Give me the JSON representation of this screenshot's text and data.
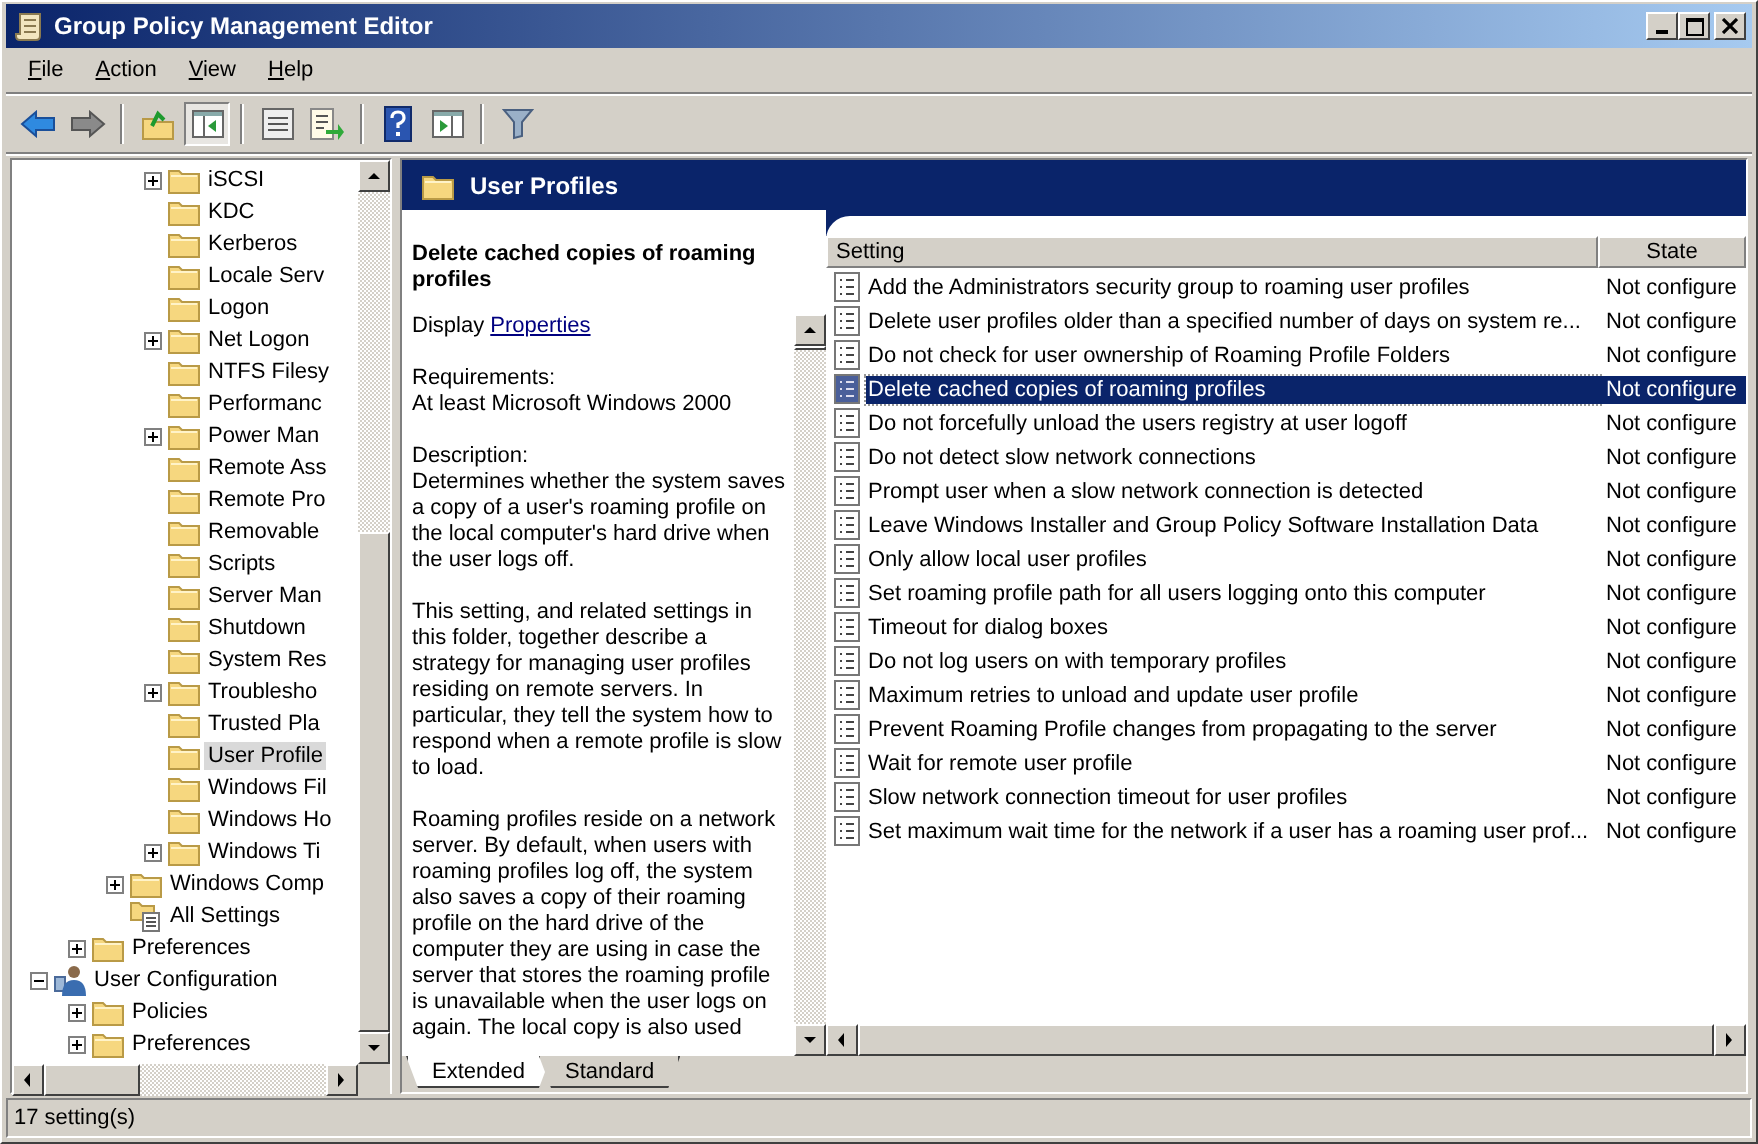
{
  "window": {
    "title": "Group Policy Management Editor"
  },
  "menu": [
    "File",
    "Action",
    "View",
    "Help"
  ],
  "toolbar": [
    [
      {
        "kind": "back",
        "pressed": false
      },
      {
        "kind": "forward",
        "pressed": false
      }
    ],
    [
      {
        "kind": "up",
        "pressed": false
      },
      {
        "kind": "tree",
        "pressed": true
      }
    ],
    [
      {
        "kind": "properties",
        "pressed": false
      },
      {
        "kind": "export",
        "pressed": false
      }
    ],
    [
      {
        "kind": "help",
        "pressed": false
      },
      {
        "kind": "action-pane",
        "pressed": false
      }
    ],
    [
      {
        "kind": "filter",
        "pressed": false
      }
    ]
  ],
  "tree": [
    {
      "children": [
        {
          "children": [
            {
              "children": [
                {
                  "label": "iSCSI",
                  "kind": "folder",
                  "expanded": false,
                  "selected": false
                },
                {
                  "label": "KDC",
                  "kind": "folder",
                  "selected": false
                },
                {
                  "label": "Kerberos",
                  "kind": "folder",
                  "selected": false
                },
                {
                  "label": "Locale Serv",
                  "kind": "folder",
                  "selected": false
                },
                {
                  "label": "Logon",
                  "kind": "folder",
                  "selected": false
                },
                {
                  "label": "Net Logon",
                  "kind": "folder",
                  "expanded": false,
                  "selected": false
                },
                {
                  "label": "NTFS Filesy",
                  "kind": "folder",
                  "selected": false
                },
                {
                  "label": "Performanc",
                  "kind": "folder",
                  "selected": false
                },
                {
                  "label": "Power Man",
                  "kind": "folder",
                  "expanded": false,
                  "selected": false
                },
                {
                  "label": "Remote Ass",
                  "kind": "folder",
                  "selected": false
                },
                {
                  "label": "Remote Pro",
                  "kind": "folder",
                  "selected": false
                },
                {
                  "label": "Removable",
                  "kind": "folder",
                  "selected": false
                },
                {
                  "label": "Scripts",
                  "kind": "folder",
                  "selected": false
                },
                {
                  "label": "Server Man",
                  "kind": "folder",
                  "selected": false
                },
                {
                  "label": "Shutdown",
                  "kind": "folder",
                  "selected": false
                },
                {
                  "label": "System Res",
                  "kind": "folder",
                  "selected": false
                },
                {
                  "label": "Troublesho",
                  "kind": "folder",
                  "expanded": false,
                  "selected": false
                },
                {
                  "label": "Trusted Pla",
                  "kind": "folder",
                  "selected": false
                },
                {
                  "label": "User Profile",
                  "kind": "folder",
                  "selected": true
                },
                {
                  "label": "Windows Fil",
                  "kind": "folder",
                  "selected": false
                },
                {
                  "label": "Windows Ho",
                  "kind": "folder",
                  "selected": false
                },
                {
                  "label": "Windows Ti",
                  "kind": "folder",
                  "expanded": false,
                  "selected": false
                }
              ]
            },
            {
              "label": "Windows Comp",
              "kind": "folder",
              "expanded": false,
              "selected": false
            },
            {
              "label": "All Settings",
              "kind": "settings",
              "selected": false
            }
          ]
        },
        {
          "label": "Preferences",
          "kind": "folder",
          "expanded": false,
          "selected": false
        }
      ]
    },
    {
      "label": "User Configuration",
      "kind": "user",
      "expanded": true,
      "selected": false,
      "children": [
        {
          "label": "Policies",
          "kind": "folder",
          "expanded": false,
          "selected": false
        },
        {
          "label": "Preferences",
          "kind": "folder",
          "expanded": false,
          "selected": false
        }
      ]
    }
  ],
  "details": {
    "header": "User Profiles",
    "title": "Delete cached copies of roaming profiles",
    "display_label": "Display",
    "display_link": "Properties",
    "requirements_label": "Requirements:",
    "requirements": "At least Microsoft Windows 2000",
    "description_label": "Description:",
    "paragraphs": [
      "Determines whether the system saves a copy of a user's roaming profile on the local computer's hard drive when the user logs off.",
      "This setting, and related settings in this folder, together describe a strategy for managing user profiles residing on remote servers. In particular, they tell the system how to respond when a remote profile is slow to load.",
      "Roaming profiles reside on a network server. By default, when users with roaming profiles log off, the system also saves a copy of their roaming profile on the hard drive of the computer they are using in case the server that stores the roaming profile is unavailable when the user logs on again. The local copy is also used"
    ]
  },
  "tabs": [
    {
      "label": "Extended",
      "selected": true
    },
    {
      "label": "Standard",
      "selected": false
    }
  ],
  "settings": {
    "columns": [
      "Setting",
      "State"
    ],
    "rows": [
      {
        "setting": "Add the Administrators security group to roaming user profiles",
        "state": "Not configure",
        "selected": false
      },
      {
        "setting": "Delete user profiles older than a specified number of days on system re...",
        "state": "Not configure",
        "selected": false
      },
      {
        "setting": "Do not check for user ownership of Roaming Profile Folders",
        "state": "Not configure",
        "selected": false
      },
      {
        "setting": "Delete cached copies of roaming profiles",
        "state": "Not configure",
        "selected": true
      },
      {
        "setting": "Do not forcefully unload the users registry at user logoff",
        "state": "Not configure",
        "selected": false
      },
      {
        "setting": "Do not detect slow network connections",
        "state": "Not configure",
        "selected": false
      },
      {
        "setting": "Prompt user when a slow network connection is detected",
        "state": "Not configure",
        "selected": false
      },
      {
        "setting": "Leave Windows Installer and Group Policy Software Installation Data",
        "state": "Not configure",
        "selected": false
      },
      {
        "setting": "Only allow local user profiles",
        "state": "Not configure",
        "selected": false
      },
      {
        "setting": "Set roaming profile path for all users logging onto this computer",
        "state": "Not configure",
        "selected": false
      },
      {
        "setting": "Timeout for dialog boxes",
        "state": "Not configure",
        "selected": false
      },
      {
        "setting": "Do not log users on with temporary profiles",
        "state": "Not configure",
        "selected": false
      },
      {
        "setting": "Maximum retries to unload and update user profile",
        "state": "Not configure",
        "selected": false
      },
      {
        "setting": "Prevent Roaming Profile changes from propagating to the server",
        "state": "Not configure",
        "selected": false
      },
      {
        "setting": "Wait for remote user profile",
        "state": "Not configure",
        "selected": false
      },
      {
        "setting": "Slow network connection timeout for user profiles",
        "state": "Not configure",
        "selected": false
      },
      {
        "setting": "Set maximum wait time for the network if a user has a roaming user prof...",
        "state": "Not configure",
        "selected": false
      }
    ]
  },
  "status_bar": "17 setting(s)"
}
